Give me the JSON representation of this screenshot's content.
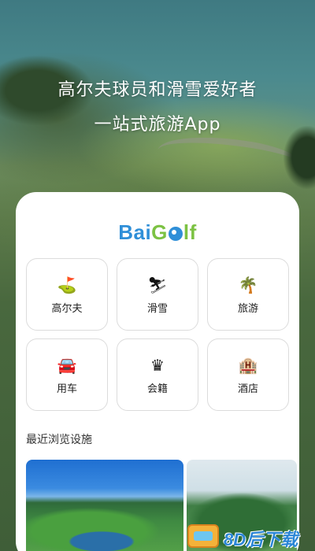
{
  "hero": {
    "line1": "高尔夫球员和滑雪爱好者",
    "line2": "一站式旅游App"
  },
  "logo": {
    "part1": "Bai",
    "part2": "G",
    "part3": "lf"
  },
  "categories": [
    {
      "label": "高尔夫",
      "icon": "golf-flag-icon",
      "glyph": "⛳"
    },
    {
      "label": "滑雪",
      "icon": "skier-icon",
      "glyph": "⛷"
    },
    {
      "label": "旅游",
      "icon": "palm-tree-icon",
      "glyph": "🌴"
    },
    {
      "label": "用车",
      "icon": "car-icon",
      "glyph": "🚘"
    },
    {
      "label": "会籍",
      "icon": "crown-icon",
      "glyph": "♛"
    },
    {
      "label": "酒店",
      "icon": "hotel-icon",
      "glyph": "🏨"
    }
  ],
  "recent": {
    "title": "最近浏览设施"
  },
  "watermark": {
    "text": "8D后下载"
  },
  "colors": {
    "logo_blue": "#2f8fd8",
    "logo_green": "#7cc243"
  }
}
